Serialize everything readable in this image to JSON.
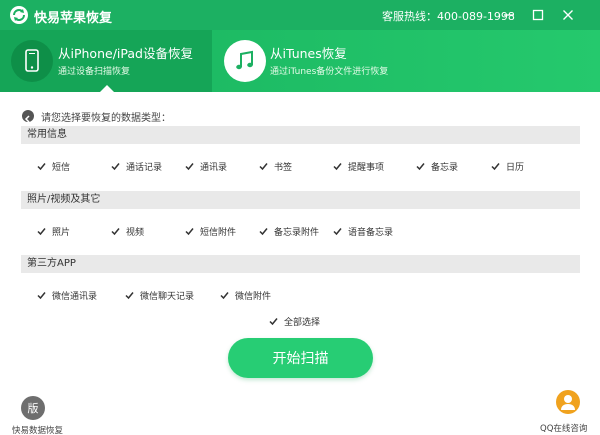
{
  "window": {
    "title": "快易苹果恢复",
    "hotline": "客服热线：400-089-1998",
    "minimize_icon": "minimize-icon",
    "maximize_icon": "maximize-icon",
    "close_icon": "close-icon"
  },
  "modes": [
    {
      "title": "从iPhone/iPad设备恢复",
      "subtitle": "通过设备扫描恢复",
      "icon": "phone-icon",
      "active": true
    },
    {
      "title": "从iTunes恢复",
      "subtitle": "通过iTunes备份文件进行恢复",
      "icon": "music-note-icon",
      "active": false
    }
  ],
  "prompt": "请您选择要恢复的数据类型：",
  "sections": [
    {
      "title": "常用信息",
      "items": [
        {
          "label": "短信",
          "checked": true
        },
        {
          "label": "通话记录",
          "checked": true
        },
        {
          "label": "通讯录",
          "checked": true
        },
        {
          "label": "书签",
          "checked": true
        },
        {
          "label": "提醒事项",
          "checked": true
        },
        {
          "label": "备忘录",
          "checked": true
        },
        {
          "label": "日历",
          "checked": true
        }
      ]
    },
    {
      "title": "照片/视频及其它",
      "items": [
        {
          "label": "照片",
          "checked": true
        },
        {
          "label": "视频",
          "checked": true
        },
        {
          "label": "短信附件",
          "checked": true
        },
        {
          "label": "备忘录附件",
          "checked": true
        },
        {
          "label": "语音备忘录",
          "checked": true
        }
      ]
    },
    {
      "title": "第三方APP",
      "items": [
        {
          "label": "微信通讯录",
          "checked": true
        },
        {
          "label": "微信聊天记录",
          "checked": true
        },
        {
          "label": "微信附件",
          "checked": true
        }
      ]
    }
  ],
  "select_all": {
    "label": "全部选择",
    "checked": true
  },
  "start_button": "开始扫描",
  "footer": {
    "left_label": "快易数据恢复",
    "left_icon_text": "版",
    "right_label": "QQ在线咨询"
  },
  "colors": {
    "brand_green": "#1cb062",
    "button_green": "#27cd74",
    "qq_orange": "#f0a21e"
  }
}
